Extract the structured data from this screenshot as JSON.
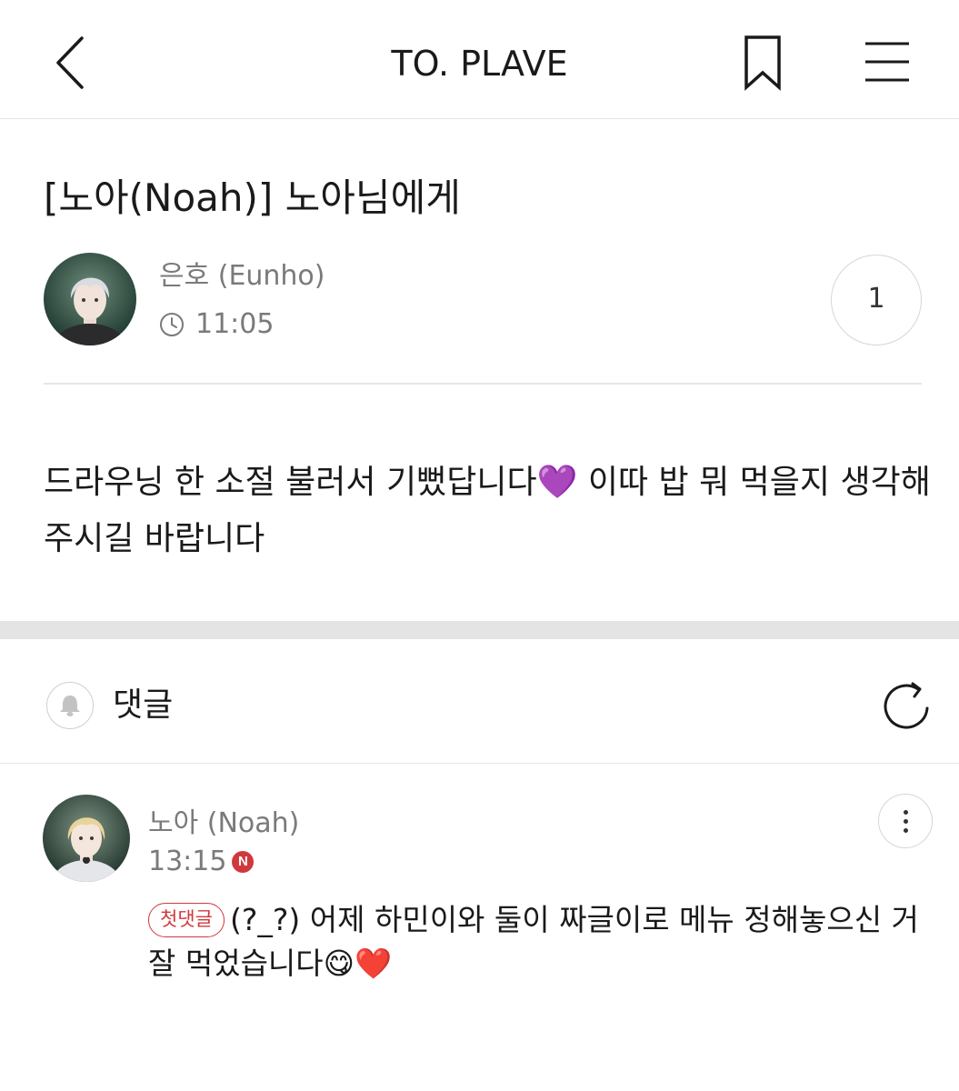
{
  "header": {
    "title": "TO. PLAVE",
    "back_icon": "chevron-left-icon",
    "bookmark_icon": "bookmark-icon",
    "menu_icon": "hamburger-menu-icon"
  },
  "post": {
    "title": "[노아(Noah)] 노아님에게",
    "author": "은호 (Eunho)",
    "time": "11:05",
    "comment_count": "1",
    "body": "드라우닝 한 소절 불러서 기뻤답니다💜 이따 밥 뭐 먹을지 생각해 주시길 바랍니다"
  },
  "comments_section": {
    "label": "댓글",
    "bell_icon": "bell-icon",
    "refresh_icon": "refresh-icon"
  },
  "comment": {
    "author": "노아 (Noah)",
    "time": "13:15",
    "new_badge": "N",
    "first_comment_label": "첫댓글",
    "text": "(?_?) 어제 하민이와 둘이 짜글이로 메뉴 정해놓으신 거 잘 먹었습니다😋❤️"
  },
  "colors": {
    "accent_red": "#d1383d",
    "muted_text": "#7a7a7a",
    "divider": "#e6e6e6"
  }
}
